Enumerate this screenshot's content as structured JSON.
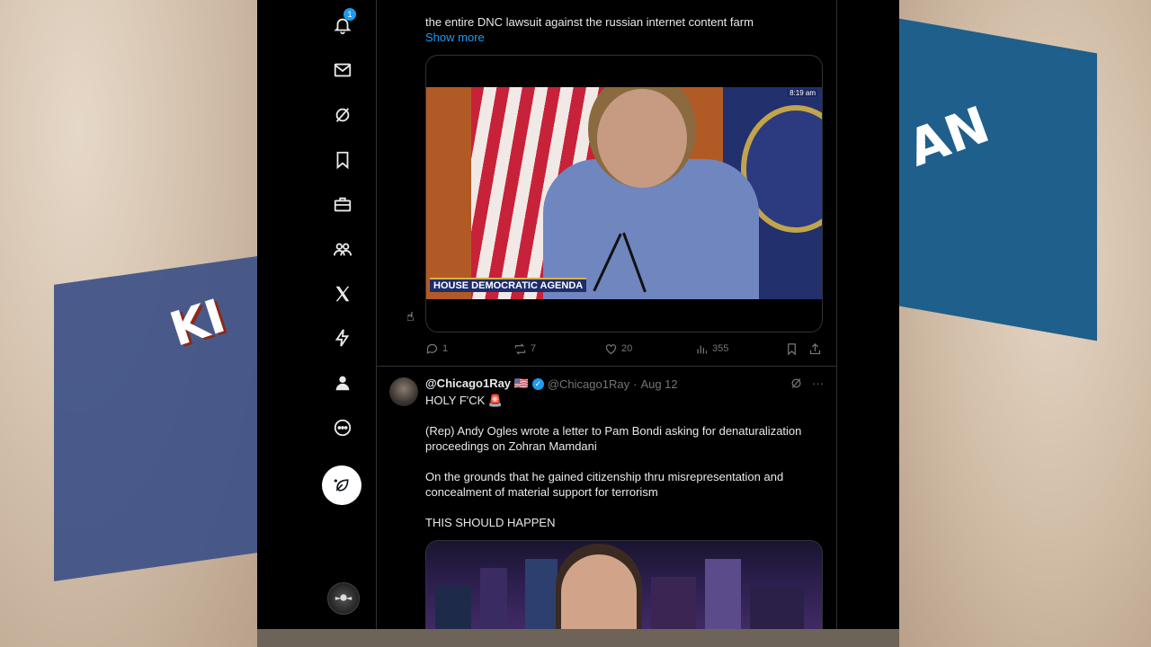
{
  "nav": {
    "notifications_badge": "1",
    "items": [
      "notifications",
      "messages",
      "grok",
      "bookmarks",
      "jobs",
      "communities",
      "premium",
      "verified-orgs",
      "profile",
      "more"
    ]
  },
  "tweet1": {
    "text": "the entire DNC lawsuit against the russian internet content farm",
    "show_more": "Show more",
    "video": {
      "chyron": "HOUSE DEMOCRATIC AGENDA",
      "timestamp": "8:19 am"
    },
    "stats": {
      "replies": "1",
      "reposts": "7",
      "likes": "20",
      "views": "355"
    }
  },
  "tweet2": {
    "display_name": "@Chicago1Ray 🇺🇸",
    "handle": "@Chicago1Ray",
    "separator": "·",
    "date": "Aug 12",
    "line1": "HOLY F'CK 🚨",
    "line2": "(Rep) Andy Ogles wrote a letter to Pam Bondi asking for denaturalization proceedings on Zohran Mamdani",
    "line3": "On the grounds that he gained citizenship thru misrepresentation and concealment of material support for terrorism",
    "line4": "THIS SHOULD HAPPEN"
  },
  "colors": {
    "background": "#000000",
    "accent": "#1d9bf0",
    "text": "#e7e9ea",
    "muted": "#71767b",
    "border": "#2f3336"
  }
}
